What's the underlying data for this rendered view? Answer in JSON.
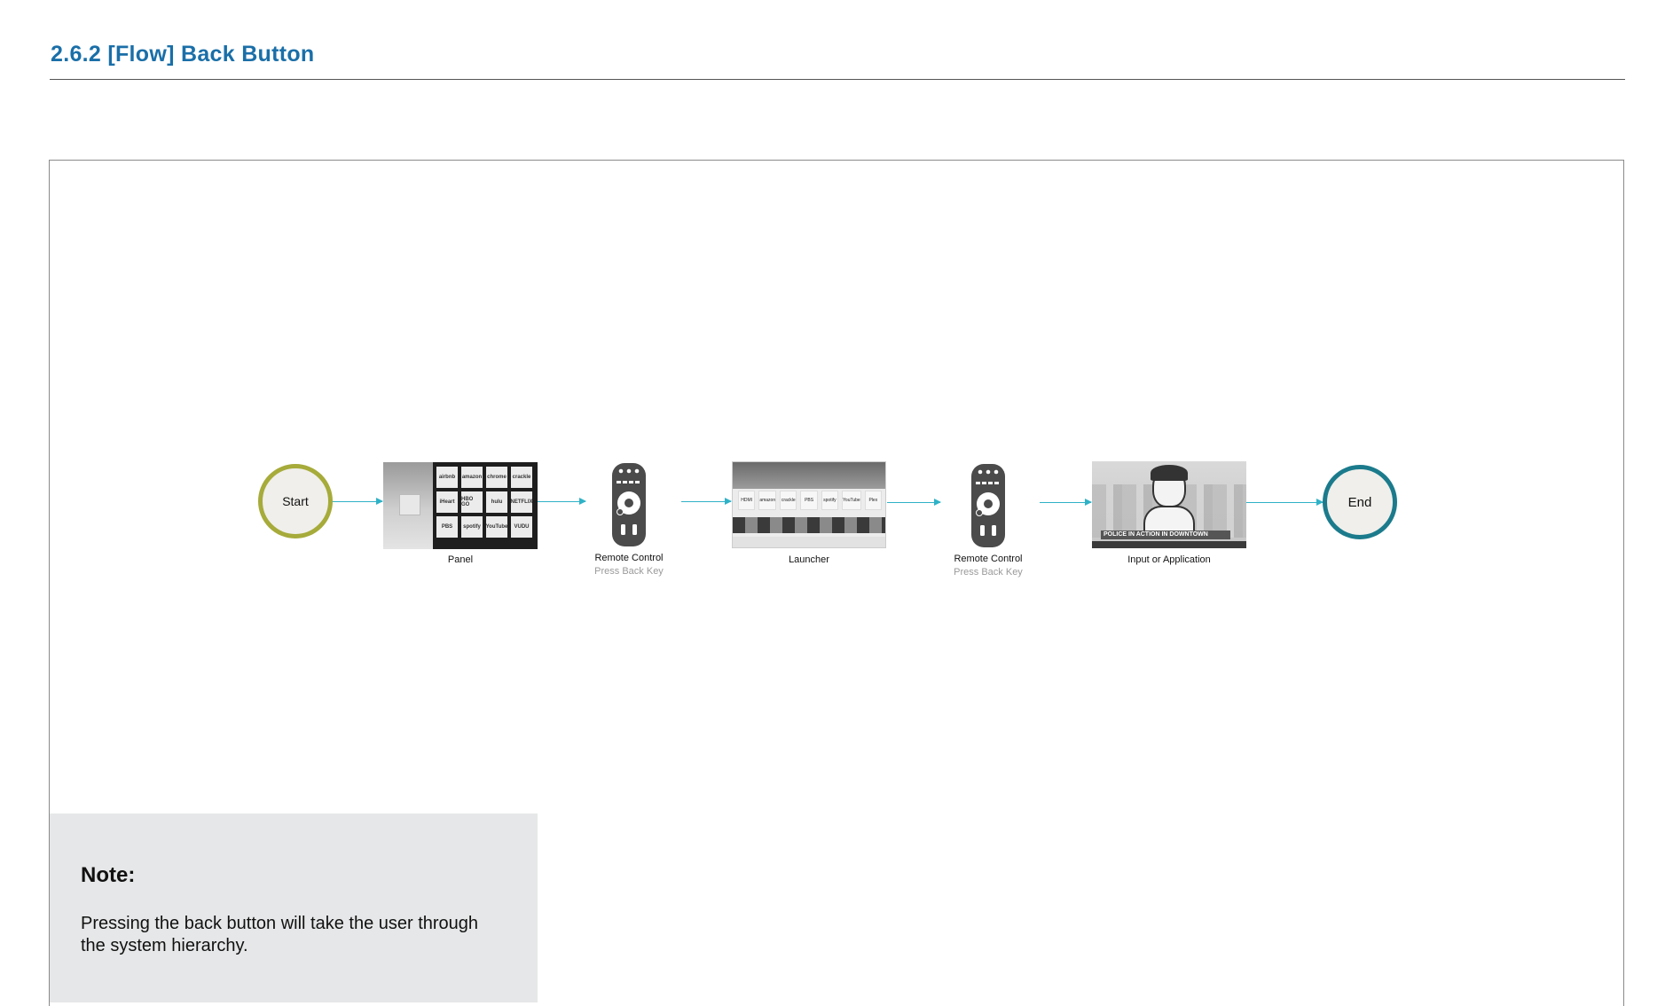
{
  "header": {
    "title": "2.6.2  [Flow] Back Button"
  },
  "flow": {
    "start_label": "Start",
    "end_label": "End",
    "steps": [
      {
        "label": "Panel",
        "sub": ""
      },
      {
        "label": "Remote Control",
        "sub": "Press Back Key"
      },
      {
        "label": "Launcher",
        "sub": ""
      },
      {
        "label": "Remote Control",
        "sub": "Press Back Key"
      },
      {
        "label": "Input or Application",
        "sub": ""
      }
    ],
    "panel_tiles": [
      "airbnb",
      "amazon",
      "chrome",
      "crackle",
      "iHeart",
      "HBO GO",
      "hulu",
      "NETFLIX",
      "PBS",
      "spotify",
      "YouTube",
      "VUDU"
    ],
    "launcher_apps": [
      "HDMI",
      "amazon",
      "crackle",
      "PBS",
      "spotify",
      "YouTube",
      "Plex"
    ],
    "news_banner": "POLICE IN ACTION IN DOWNTOWN"
  },
  "colors": {
    "title": "#1a6fa8",
    "start_ring": "#a6ab3a",
    "end_ring": "#1b7b8c",
    "connector": "#2fb2c7",
    "note_bg": "#e6e7e8"
  },
  "note": {
    "title": "Note:",
    "body": "Pressing the back button will take the user through the system hierarchy."
  }
}
